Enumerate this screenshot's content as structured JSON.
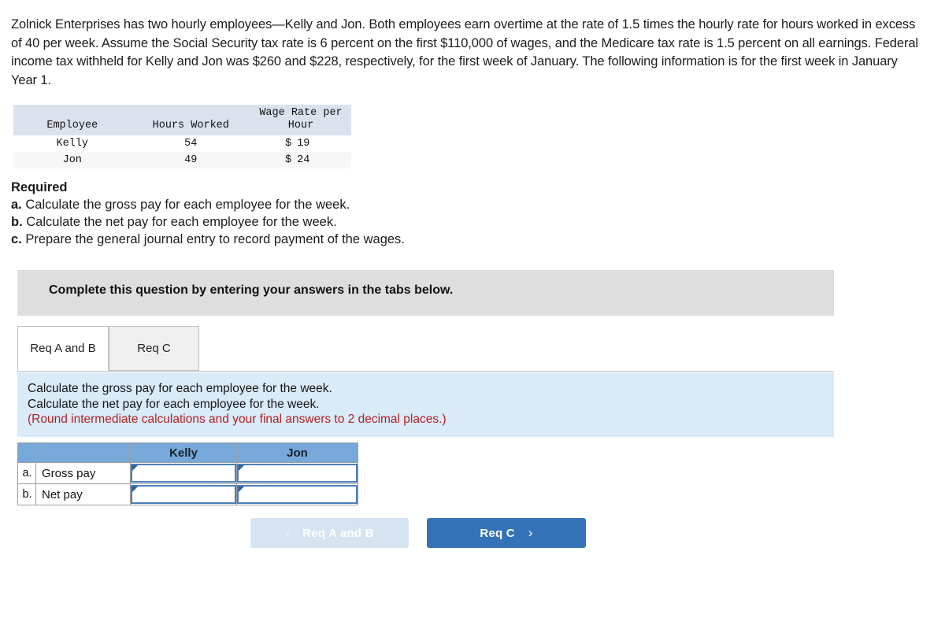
{
  "problem": {
    "text": "Zolnick Enterprises has two hourly employees—Kelly and Jon. Both employees earn overtime at the rate of 1.5 times the hourly rate for hours worked in excess of 40 per week. Assume the Social Security tax rate is 6 percent on the first $110,000 of wages, and the Medicare tax rate is 1.5 percent on all earnings. Federal income tax withheld for Kelly and Jon was $260 and $228, respectively, for the first week of January. The following information is for the first week in January Year 1."
  },
  "data_table": {
    "headers": {
      "employee": "Employee",
      "hours_worked": "Hours Worked",
      "wage_rate_line1": "Wage Rate per",
      "wage_rate_line2": "Hour"
    },
    "rows": [
      {
        "employee": "Kelly",
        "hours": "54",
        "currency": "$",
        "rate": "19"
      },
      {
        "employee": "Jon",
        "hours": "49",
        "currency": "$",
        "rate": "24"
      }
    ]
  },
  "required": {
    "title": "Required",
    "items": [
      {
        "label": "a.",
        "text": "Calculate the gross pay for each employee for the week."
      },
      {
        "label": "b.",
        "text": "Calculate the net pay for each employee for the week."
      },
      {
        "label": "c.",
        "text": "Prepare the general journal entry to record payment of the wages."
      }
    ]
  },
  "banner": {
    "text": "Complete this question by entering your answers in the tabs below."
  },
  "tabs": [
    {
      "label": "Req A and B",
      "active": true
    },
    {
      "label": "Req C",
      "active": false
    }
  ],
  "instructions": {
    "line1": "Calculate the gross pay for each employee for the week.",
    "line2": "Calculate the net pay for each employee for the week.",
    "line3": "(Round intermediate calculations and your final answers to 2 decimal places.)"
  },
  "answer_table": {
    "headers": {
      "index": "",
      "label": "",
      "kelly": "Kelly",
      "jon": "Jon"
    },
    "rows": [
      {
        "index": "a.",
        "label": "Gross pay",
        "kelly": "",
        "jon": ""
      },
      {
        "index": "b.",
        "label": "Net pay",
        "kelly": "",
        "jon": ""
      }
    ]
  },
  "navigation": {
    "prev": {
      "label": "Req A and B",
      "icon": "chevron-left",
      "glyph": "‹",
      "disabled": true
    },
    "next": {
      "label": "Req C",
      "icon": "chevron-right",
      "glyph": "›",
      "disabled": false
    }
  },
  "colors": {
    "banner_bg": "#dedede",
    "instruction_panel_bg": "#d9eaf8",
    "instruction_warning": "#b42020",
    "table_header_blue": "#76a9da",
    "data_header_bg": "#dbe2ee",
    "button_active_bg": "#3573b9",
    "button_disabled_bg": "#d6e4f2",
    "input_border": "#4a7ebb"
  }
}
